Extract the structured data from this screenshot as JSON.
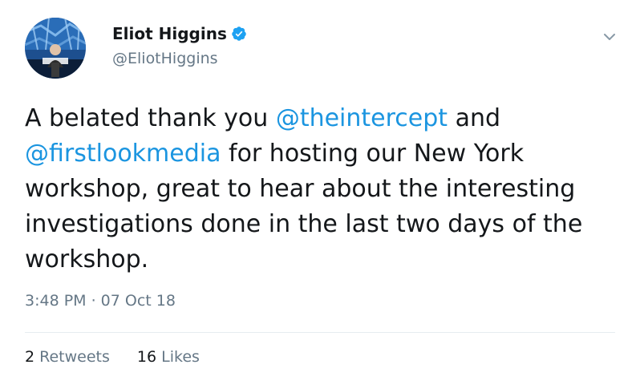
{
  "author": {
    "display_name": "Eliot Higgins",
    "handle": "@EliotHiggins",
    "verified": true,
    "avatar_icon": "profile-photo",
    "verified_icon": "verified-badge-icon",
    "menu_icon": "chevron-down-icon"
  },
  "tweet": {
    "text_parts": [
      {
        "type": "text",
        "value": "A belated thank you "
      },
      {
        "type": "mention",
        "value": "@theintercept"
      },
      {
        "type": "text",
        "value": " and "
      },
      {
        "type": "mention",
        "value": "@firstlookmedia"
      },
      {
        "type": "text",
        "value": " for hosting our New York workshop, great to hear about the interesting investigations done in the last two days of the workshop."
      }
    ],
    "timestamp": "3:48 PM · 07 Oct 18"
  },
  "stats": {
    "retweets_count": "2",
    "retweets_label": "Retweets",
    "likes_count": "16",
    "likes_label": "Likes"
  },
  "colors": {
    "link": "#1b95e0",
    "secondary_text": "#657786",
    "primary_text": "#14171a",
    "divider": "#e6ecf0",
    "verified": "#1da1f2"
  }
}
